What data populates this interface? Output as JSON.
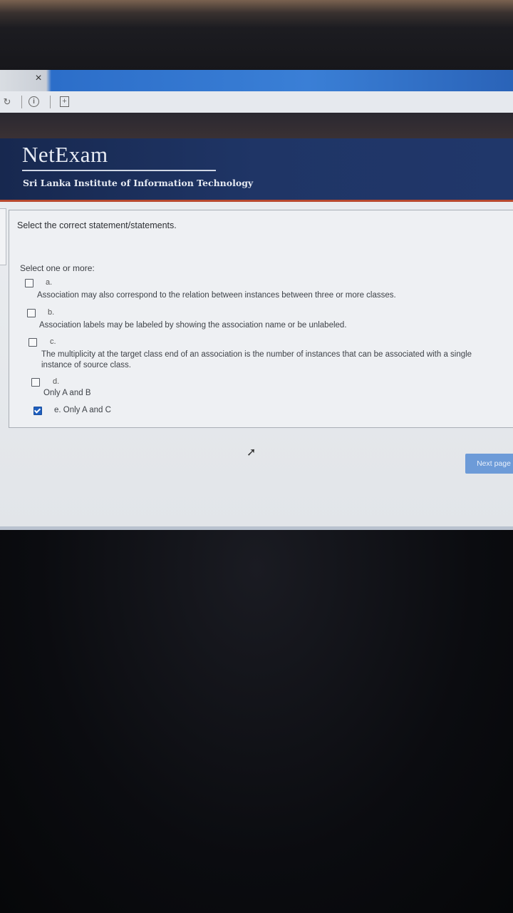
{
  "browser": {
    "close_tab_label": "×",
    "icons": [
      "refresh-icon",
      "info-icon",
      "new-tab-icon"
    ]
  },
  "site": {
    "logo_title": "NetExam",
    "logo_subtitle": "Sri Lanka Institute of Information Technology"
  },
  "question": {
    "prompt": "Select the correct statement/statements.",
    "hint": "Select one or more:",
    "options": [
      {
        "letter": "a.",
        "text": "Association may also correspond to the relation between instances between three or more classes.",
        "checked": false
      },
      {
        "letter": "b.",
        "text": "Association labels may be labeled by showing the association name or be unlabeled.",
        "checked": false
      },
      {
        "letter": "c.",
        "text": "The multiplicity at the target class end of an association is the number of instances that can be associated with a single instance of source class.",
        "checked": false
      },
      {
        "letter": "d.",
        "text": "Only A and B",
        "checked": false
      },
      {
        "letter": "",
        "text": "e. Only A and C",
        "checked": true
      }
    ]
  },
  "nav": {
    "next_label": "Next page"
  },
  "colors": {
    "header_bg": "#1f3566",
    "accent_rule": "#b8492e",
    "next_button": "#6d9bd8",
    "checkbox_checked": "#1f5fbf"
  }
}
